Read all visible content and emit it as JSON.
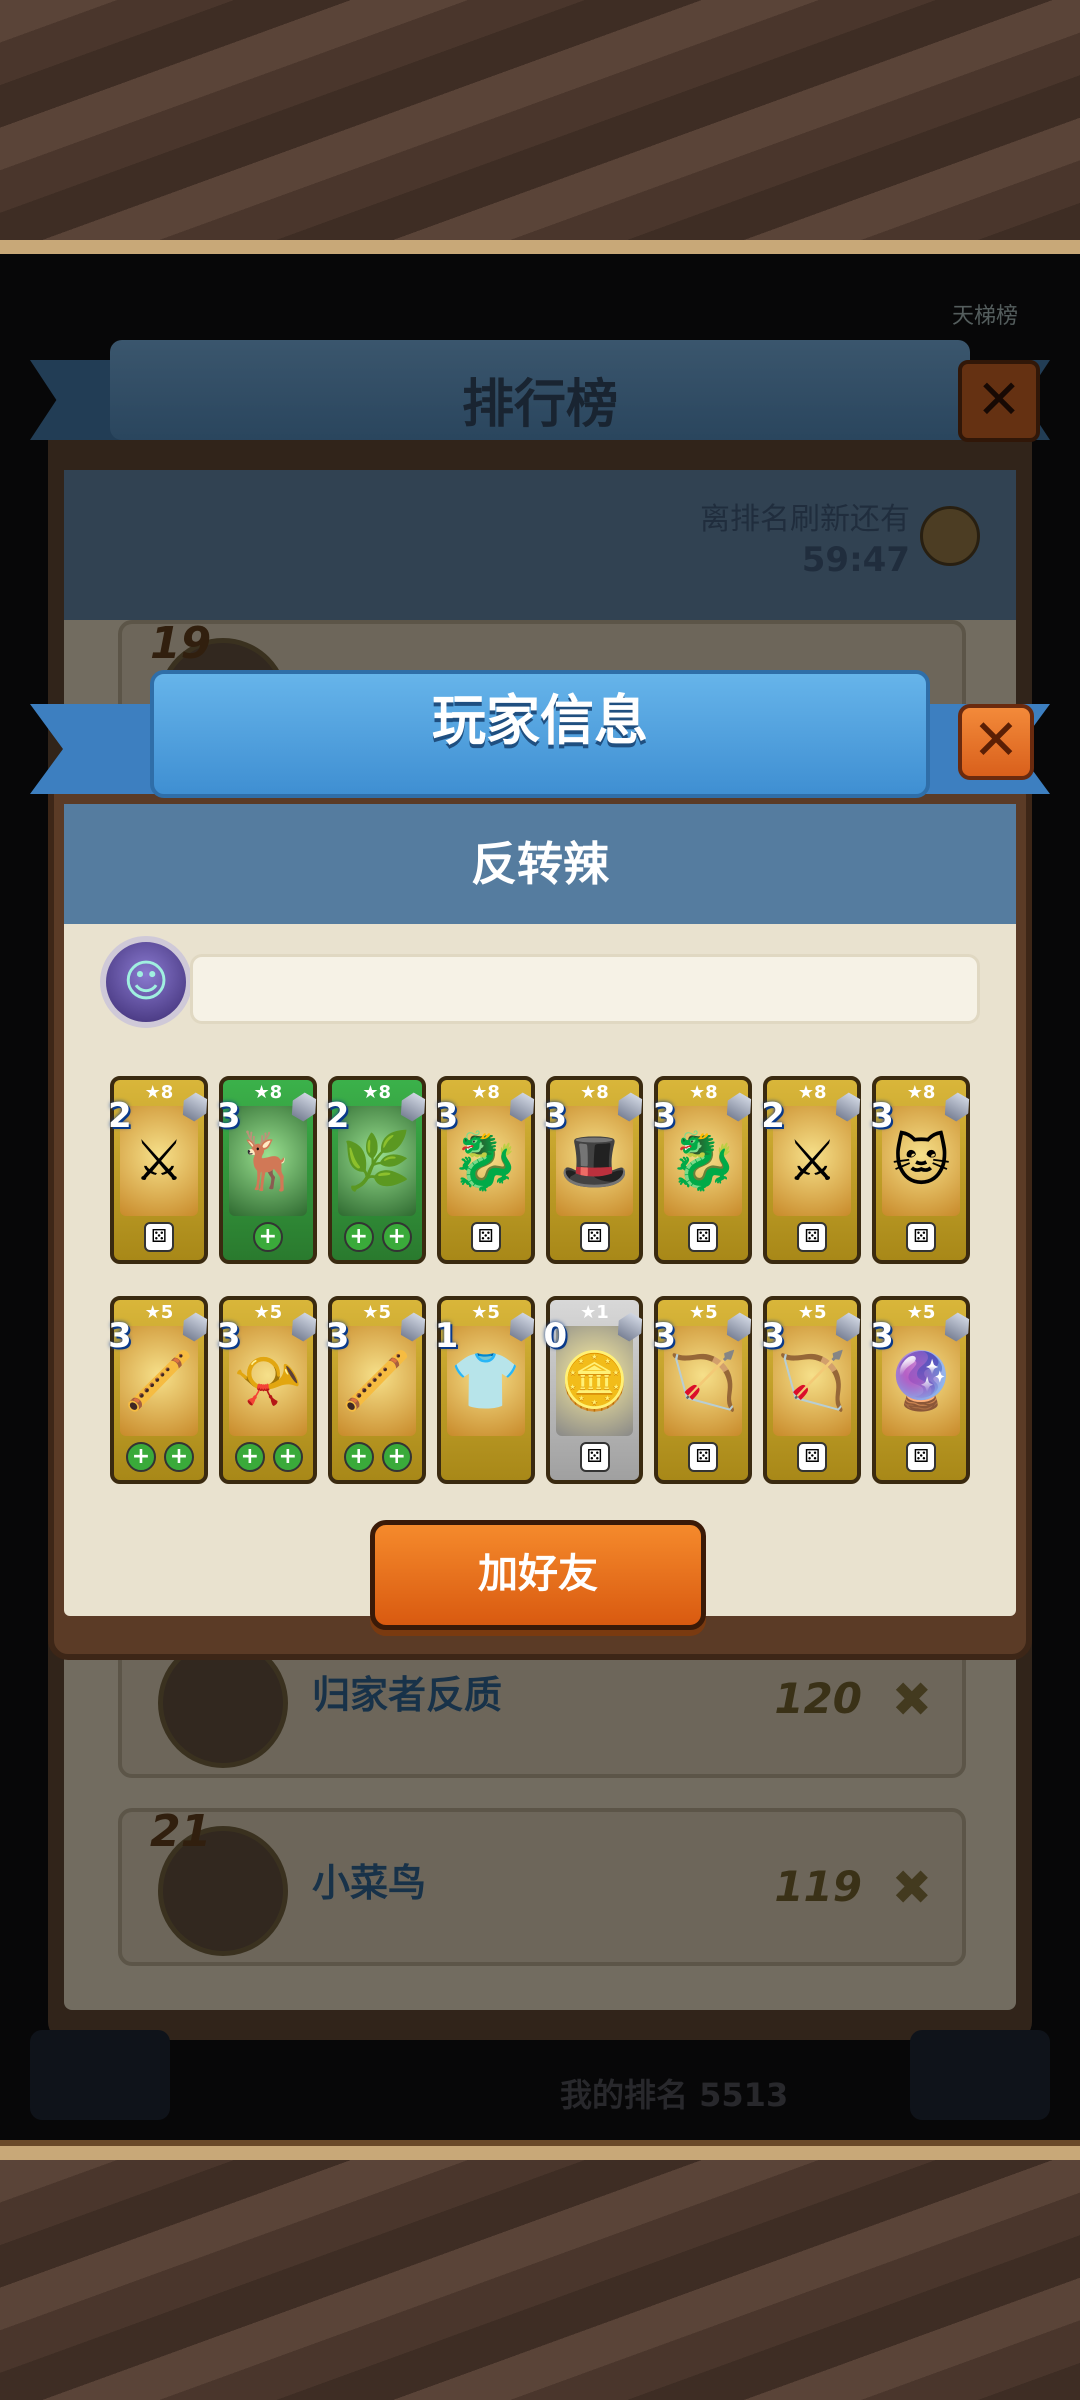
{
  "background": {
    "leaderboard_title": "排行榜",
    "partial_tab_label": "天梯榜",
    "refresh_label": "离排名刷新还有",
    "refresh_time": "59:47",
    "rows": [
      {
        "name": "归家者反质",
        "score": "120",
        "rank": ""
      },
      {
        "name": "小菜鸟",
        "score": "119",
        "rank": "21"
      }
    ],
    "partial_top_rank": "19",
    "footer_text": "我的排名 5513"
  },
  "modal": {
    "title": "玩家信息",
    "player_name": "反转辣",
    "close_icon": "✕",
    "add_friend_label": "加好友"
  },
  "deck": {
    "heroes": [
      {
        "stars": "★8",
        "level": "2",
        "art": "⚔",
        "color": "gold",
        "badges": [
          "dice"
        ]
      },
      {
        "stars": "★8",
        "level": "3",
        "art": "🦌",
        "color": "green",
        "badges": [
          "plus"
        ]
      },
      {
        "stars": "★8",
        "level": "2",
        "art": "🌿",
        "color": "green",
        "badges": [
          "plus",
          "plus"
        ]
      },
      {
        "stars": "★8",
        "level": "3",
        "art": "🐉",
        "color": "gold",
        "badges": [
          "dice"
        ]
      },
      {
        "stars": "★8",
        "level": "3",
        "art": "🎩",
        "color": "gold",
        "badges": [
          "dice"
        ]
      },
      {
        "stars": "★8",
        "level": "3",
        "art": "🐉",
        "color": "gold",
        "badges": [
          "dice"
        ]
      },
      {
        "stars": "★8",
        "level": "2",
        "art": "⚔",
        "color": "gold",
        "badges": [
          "dice"
        ]
      },
      {
        "stars": "★8",
        "level": "3",
        "art": "🐱",
        "color": "gold",
        "badges": [
          "dice"
        ]
      }
    ],
    "items": [
      {
        "stars": "★5",
        "level": "3",
        "art": "🪈",
        "color": "gold",
        "badges": [
          "plus",
          "plus"
        ]
      },
      {
        "stars": "★5",
        "level": "3",
        "art": "📯",
        "color": "gold",
        "badges": [
          "plus",
          "plus"
        ]
      },
      {
        "stars": "★5",
        "level": "3",
        "art": "🪈",
        "color": "gold",
        "badges": [
          "plus",
          "plus"
        ]
      },
      {
        "stars": "★5",
        "level": "1",
        "art": "👕",
        "color": "gold",
        "badges": []
      },
      {
        "stars": "★1",
        "level": "0",
        "art": "🪙",
        "color": "silver",
        "badges": [
          "dice"
        ]
      },
      {
        "stars": "★5",
        "level": "3",
        "art": "🏹",
        "color": "gold",
        "badges": [
          "dice"
        ]
      },
      {
        "stars": "★5",
        "level": "3",
        "art": "🏹",
        "color": "gold",
        "badges": [
          "dice"
        ]
      },
      {
        "stars": "★5",
        "level": "3",
        "art": "🔮",
        "color": "gold",
        "badges": [
          "dice"
        ]
      }
    ]
  }
}
